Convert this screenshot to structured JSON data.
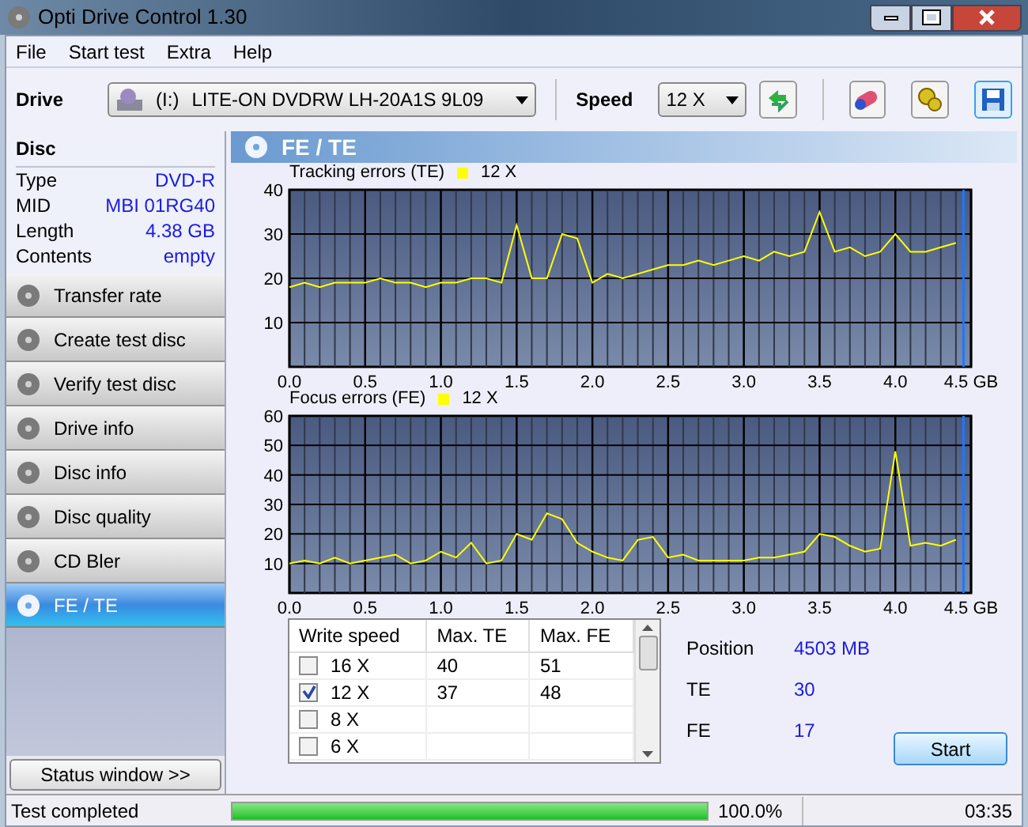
{
  "window": {
    "title": "Opti Drive Control 1.30"
  },
  "menu": [
    "File",
    "Start test",
    "Extra",
    "Help"
  ],
  "toolbar": {
    "drive_label": "Drive",
    "drive_letter": "(I:)",
    "drive": "LITE-ON DVDRW LH-20A1S 9L09",
    "speed_label": "Speed",
    "speed": "12 X"
  },
  "disc": {
    "title": "Disc",
    "fields": [
      {
        "label": "Type",
        "value": "DVD-R"
      },
      {
        "label": "MID",
        "value": "MBI 01RG40"
      },
      {
        "label": "Length",
        "value": "4.38 GB"
      },
      {
        "label": "Contents",
        "value": "empty"
      }
    ]
  },
  "sidebar": {
    "items": [
      {
        "label": "Transfer rate",
        "selected": false
      },
      {
        "label": "Create test disc",
        "selected": false
      },
      {
        "label": "Verify test disc",
        "selected": false
      },
      {
        "label": "Drive info",
        "selected": false
      },
      {
        "label": "Disc info",
        "selected": false
      },
      {
        "label": "Disc quality",
        "selected": false
      },
      {
        "label": "CD Bler",
        "selected": false
      },
      {
        "label": "FE / TE",
        "selected": true
      }
    ],
    "status_button": "Status window >>"
  },
  "panel": {
    "title": "FE / TE"
  },
  "charts": [
    {
      "chart_data": {
        "type": "line",
        "title": "Tracking errors (TE)",
        "x": [
          0,
          0.1,
          0.2,
          0.3,
          0.4,
          0.5,
          0.6,
          0.7,
          0.8,
          0.9,
          1.0,
          1.1,
          1.2,
          1.3,
          1.4,
          1.5,
          1.6,
          1.7,
          1.8,
          1.9,
          2.0,
          2.1,
          2.2,
          2.3,
          2.4,
          2.5,
          2.6,
          2.7,
          2.8,
          2.9,
          3.0,
          3.1,
          3.2,
          3.3,
          3.4,
          3.5,
          3.6,
          3.7,
          3.8,
          3.9,
          4.0,
          4.1,
          4.2,
          4.3,
          4.4
        ],
        "series": [
          {
            "name": "12 X",
            "color": "#ffff00",
            "values": [
              18,
              19,
              18,
              19,
              19,
              19,
              20,
              19,
              19,
              18,
              19,
              19,
              20,
              20,
              19,
              32,
              20,
              20,
              30,
              29,
              19,
              21,
              20,
              21,
              22,
              23,
              23,
              24,
              23,
              24,
              25,
              24,
              26,
              25,
              26,
              35,
              26,
              27,
              25,
              26,
              30,
              26,
              26,
              27,
              28
            ]
          }
        ],
        "xlim": [
          0,
          4.5
        ],
        "ylim": [
          0,
          40
        ],
        "grid": true,
        "ref_lines": [
          {
            "axis": "x",
            "value": 4.45,
            "color": "#1e78ff"
          }
        ],
        "xticks": [
          {
            "value": 0,
            "label": "0.0"
          },
          0.5,
          {
            "value": 1,
            "label": "1.0"
          },
          1.5,
          {
            "value": 2,
            "label": "2.0"
          },
          2.5,
          {
            "value": 3,
            "label": "3.0"
          },
          3.5,
          {
            "value": 4,
            "label": "4.0"
          },
          {
            "value": 4.5,
            "label": "4.5 GB"
          }
        ],
        "yticks": [
          10,
          20,
          30,
          40
        ]
      }
    },
    {
      "chart_data": {
        "type": "line",
        "title": "Focus errors (FE)",
        "x": [
          0,
          0.1,
          0.2,
          0.3,
          0.4,
          0.5,
          0.6,
          0.7,
          0.8,
          0.9,
          1.0,
          1.1,
          1.2,
          1.3,
          1.4,
          1.5,
          1.6,
          1.7,
          1.8,
          1.9,
          2.0,
          2.1,
          2.2,
          2.3,
          2.4,
          2.5,
          2.6,
          2.7,
          2.8,
          2.9,
          3.0,
          3.1,
          3.2,
          3.3,
          3.4,
          3.5,
          3.6,
          3.7,
          3.8,
          3.9,
          4.0,
          4.1,
          4.2,
          4.3,
          4.4
        ],
        "series": [
          {
            "name": "12 X",
            "color": "#ffff00",
            "values": [
              10,
              11,
              10,
              12,
              10,
              11,
              12,
              13,
              10,
              11,
              14,
              12,
              17,
              10,
              11,
              20,
              18,
              27,
              25,
              17,
              14,
              12,
              11,
              18,
              19,
              12,
              13,
              11,
              11,
              11,
              11,
              12,
              12,
              13,
              14,
              20,
              19,
              16,
              14,
              15,
              48,
              16,
              17,
              16,
              18
            ]
          }
        ],
        "xlim": [
          0,
          4.5
        ],
        "ylim": [
          0,
          60
        ],
        "grid": true,
        "ref_lines": [
          {
            "axis": "x",
            "value": 4.45,
            "color": "#1e78ff"
          }
        ],
        "xticks": [
          {
            "value": 0,
            "label": "0.0"
          },
          0.5,
          {
            "value": 1,
            "label": "1.0"
          },
          1.5,
          {
            "value": 2,
            "label": "2.0"
          },
          2.5,
          {
            "value": 3,
            "label": "3.0"
          },
          3.5,
          {
            "value": 4,
            "label": "4.0"
          },
          {
            "value": 4.5,
            "label": "4.5 GB"
          }
        ],
        "yticks": [
          10,
          20,
          30,
          40,
          50,
          60
        ]
      }
    }
  ],
  "table": {
    "columns": [
      "Write speed",
      "Max. TE",
      "Max. FE"
    ],
    "rows": [
      {
        "speed": "16 X",
        "max_te": "40",
        "max_fe": "51",
        "checked": false
      },
      {
        "speed": "12 X",
        "max_te": "37",
        "max_fe": "48",
        "checked": true
      },
      {
        "speed": "8 X",
        "checked": false
      },
      {
        "speed": "6 X",
        "checked": false
      }
    ]
  },
  "stats": [
    {
      "label": "Position",
      "value": "4503 MB"
    },
    {
      "label": "TE",
      "value": "30"
    },
    {
      "label": "FE",
      "value": "17"
    }
  ],
  "start_button": "Start",
  "status_bar": {
    "text": "Test completed",
    "level": 1.0,
    "percent": "100.0%",
    "time": "03:35"
  }
}
